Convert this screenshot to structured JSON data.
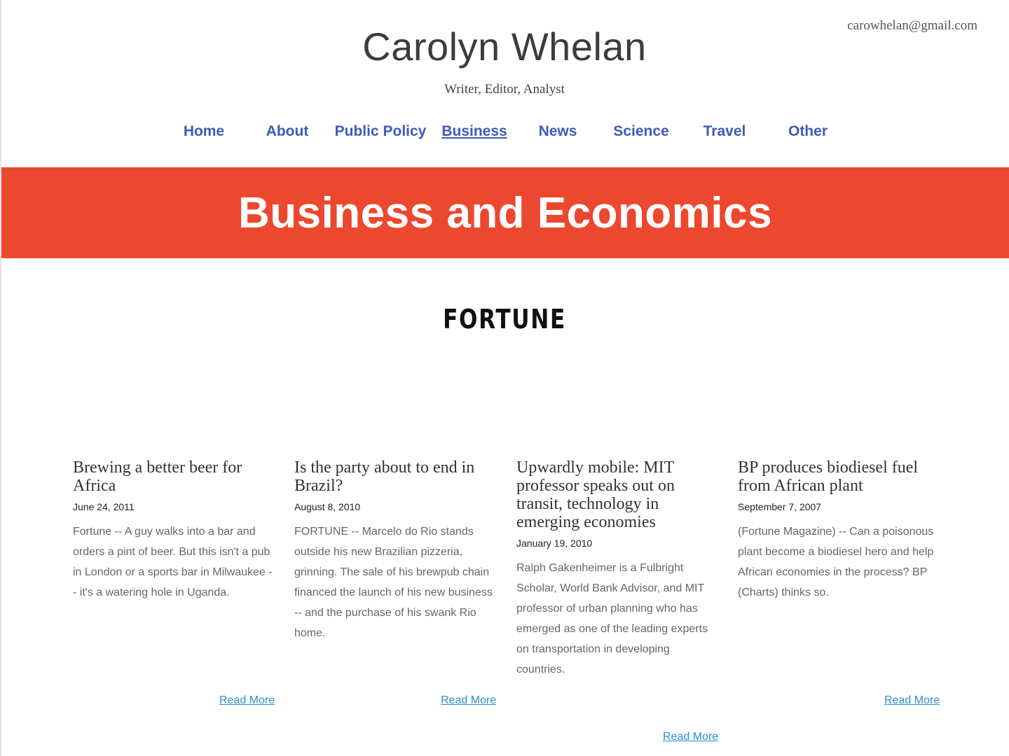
{
  "header": {
    "email": "carowhelan@gmail.com",
    "site_title": "Carolyn Whelan",
    "tagline": "Writer, Editor, Analyst"
  },
  "nav": {
    "items": [
      {
        "label": "Home"
      },
      {
        "label": "About"
      },
      {
        "label": "Public Policy"
      },
      {
        "label": "Business",
        "active": true
      },
      {
        "label": "News"
      },
      {
        "label": "Science"
      },
      {
        "label": "Travel"
      },
      {
        "label": "Other"
      }
    ]
  },
  "banner": {
    "title": "Business and Economics",
    "color": "#ec4830"
  },
  "publication": {
    "logo_text": "FORTUNE"
  },
  "articles": [
    {
      "title": "Brewing a better beer for Africa",
      "date": "June 24, 2011",
      "excerpt": "Fortune -- A guy walks into a bar and orders a pint of beer. But this isn't a pub in London or a sports bar in Milwaukee -- it's a watering hole in Uganda.",
      "read_more": "Read More"
    },
    {
      "title": "Is the party about to end in Brazil?",
      "date": "August 8, 2010",
      "excerpt": "FORTUNE -- Marcelo do Rio stands outside his new Brazilian pizzeria, grinning. The sale of his brewpub chain financed the launch of his new business -- and the purchase of his swank Rio home.",
      "read_more": "Read More"
    },
    {
      "title": "Upwardly mobile: MIT professor speaks out on transit, technology in emerging economies",
      "date": "January 19, 2010",
      "excerpt": "Ralph Gakenheimer is a Fulbright Scholar, World Bank Advisor, and MIT professor of urban planning who has emerged as one of the leading experts on transportation in developing countries.",
      "read_more": "Read More"
    },
    {
      "title": "BP produces biodiesel fuel from African plant",
      "date": "September 7, 2007",
      "excerpt": "(Fortune Magazine) -- Can a poisonous plant become a biodiesel hero and help African economies in the process? BP (Charts) thinks so.",
      "read_more": "Read More"
    }
  ],
  "colors": {
    "nav_link": "#3d5bb8",
    "read_more_link": "#2a8ed6"
  }
}
